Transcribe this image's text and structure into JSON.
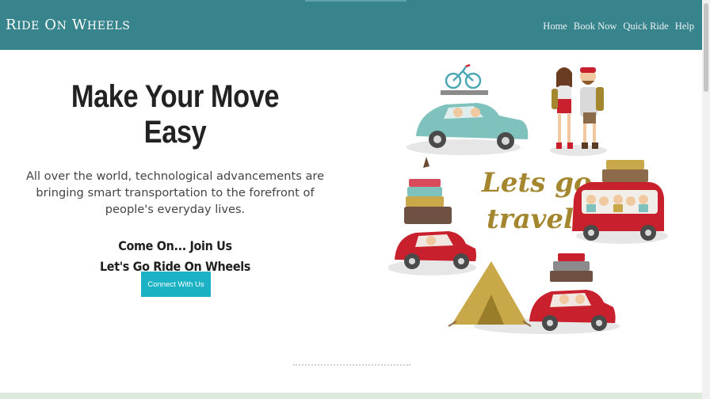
{
  "header": {
    "brand": {
      "r": "R",
      "ide": "IDE",
      "o": "O",
      "n": "N",
      "w": "W",
      "heels": "HEELS"
    },
    "nav": [
      "Home",
      "Book Now",
      "Quick Ride",
      "Help"
    ]
  },
  "hero": {
    "headline": "Make Your Move Easy",
    "description": "All over the world, technological advancements are bringing smart transportation to the forefront of people's everyday lives.",
    "cta_line1": "Come On... Join Us",
    "cta_line2": "Let's Go Ride On Wheels",
    "button": "Connect With Us"
  },
  "illustration": {
    "text_line1": "Lets go",
    "text_line2": "travel!"
  },
  "colors": {
    "nav_bg": "#38848c",
    "button_bg": "#1cb2c5",
    "car_red": "#c8202c",
    "car_teal": "#7fc1bd",
    "lettering": "#a3862e"
  }
}
